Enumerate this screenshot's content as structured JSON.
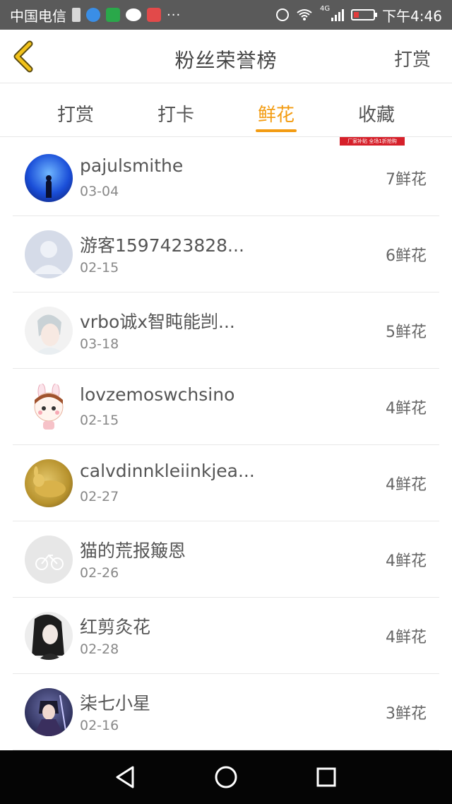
{
  "status_bar": {
    "carrier": "中国电信",
    "dots": "···",
    "time": "下午4:46",
    "network": "4G"
  },
  "header": {
    "title": "粉丝荣誉榜",
    "action": "打赏"
  },
  "tabs": [
    {
      "label": "打赏",
      "active": false
    },
    {
      "label": "打卡",
      "active": false
    },
    {
      "label": "鲜花",
      "active": true
    },
    {
      "label": "收藏",
      "active": false
    }
  ],
  "promo_banner": "厂家补贴 全场1折抢购",
  "rows": [
    {
      "name": "pajulsmithe",
      "date": "03-04",
      "count": "7鲜花"
    },
    {
      "name": "游客1597423828...",
      "date": "02-15",
      "count": "6鲜花"
    },
    {
      "name": "vrbo诚x智盹能剀...",
      "date": "03-18",
      "count": "5鲜花"
    },
    {
      "name": "lovzemoswchsino",
      "date": "02-15",
      "count": "4鲜花"
    },
    {
      "name": "calvdinnkleiinkjea...",
      "date": "02-27",
      "count": "4鲜花"
    },
    {
      "name": "猫的荒报簸恩",
      "date": "02-26",
      "count": "4鲜花"
    },
    {
      "name": "红剪灸花",
      "date": "02-28",
      "count": "4鲜花"
    },
    {
      "name": "柒七小星",
      "date": "02-16",
      "count": "3鲜花"
    }
  ],
  "colors": {
    "accent": "#f39c12",
    "status_bar": "#5a5a5a",
    "nav_bar": "#050505"
  }
}
